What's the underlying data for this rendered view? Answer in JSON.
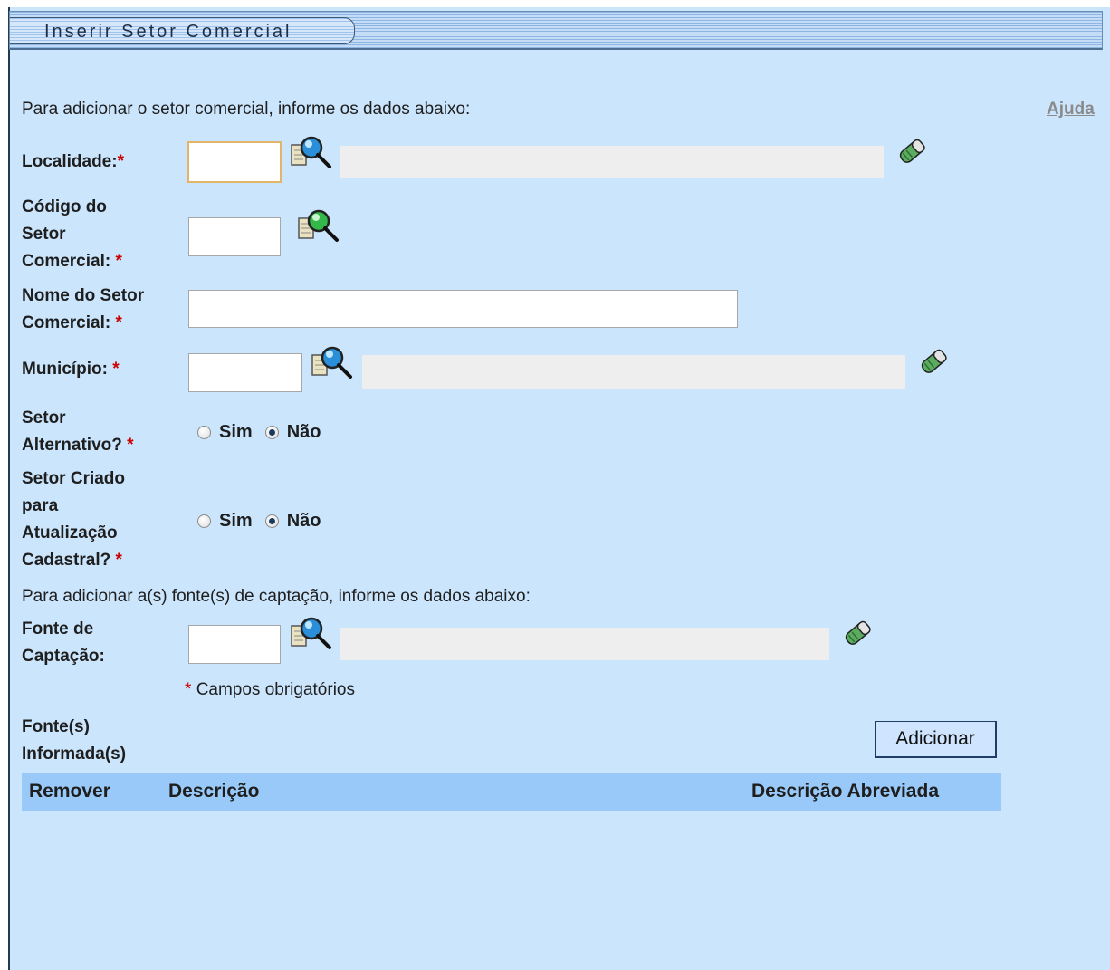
{
  "header": {
    "title": "Inserir Setor Comercial"
  },
  "form": {
    "intro": "Para adicionar o setor comercial, informe os dados abaixo:",
    "help_link": "Ajuda",
    "localidade": {
      "label": "Localidade:",
      "value": ""
    },
    "codigo_setor": {
      "label_1": "Código do",
      "label_2": "Setor",
      "label_3": "Comercial:",
      "value": ""
    },
    "nome_setor": {
      "label_1": "Nome do Setor",
      "label_2": "Comercial:",
      "value": ""
    },
    "municipio": {
      "label": "Município:",
      "value": ""
    },
    "setor_alternativo": {
      "label_1": "Setor",
      "label_2": "Alternativo?",
      "options": [
        "Sim",
        "Não"
      ],
      "selected": "Não"
    },
    "setor_criado": {
      "label_1": "Setor Criado",
      "label_2": "para",
      "label_3": "Atualização",
      "label_4": "Cadastral?",
      "options": [
        "Sim",
        "Não"
      ],
      "selected": "Não"
    },
    "required_marker": "*"
  },
  "captacao": {
    "intro": "Para adicionar a(s) fonte(s) de captação, informe os dados abaixo:",
    "fonte": {
      "label_1": "Fonte de",
      "label_2": "Captação:",
      "value": ""
    },
    "required_note": "Campos obrigatórios",
    "informed_label_1": "Fonte(s)",
    "informed_label_2": "Informada(s)",
    "add_button": "Adicionar"
  },
  "table": {
    "columns": [
      "Remover",
      "Descrição",
      "Descrição Abreviada"
    ],
    "rows": []
  },
  "colors": {
    "panel_bg": "#cbe5fc",
    "table_header_bg": "#99c9f8",
    "required": "#cc0000",
    "help_link": "#8a8a8a"
  }
}
